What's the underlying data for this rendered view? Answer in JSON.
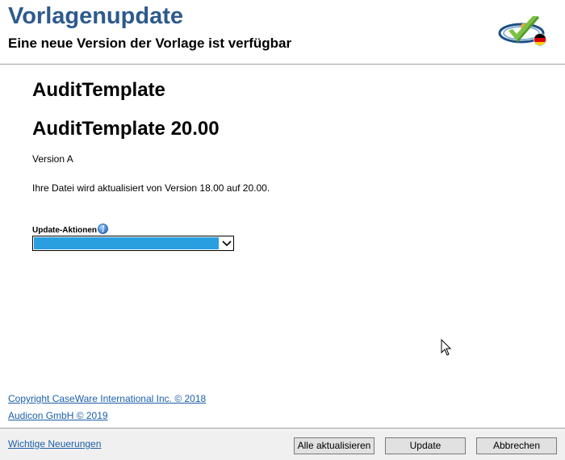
{
  "header": {
    "title": "Vorlagenupdate",
    "subtitle": "Eine neue Version der Vorlage ist verfügbar",
    "logo_icon": "caseware-check-logo-germany",
    "title_color": "#2e5a8c"
  },
  "template": {
    "name": "AuditTemplate",
    "version_title": "AuditTemplate 20.00",
    "version_label": "Version A",
    "update_message": "Ihre Datei wird aktualisiert von Version 18.00 auf 20.00."
  },
  "update_actions": {
    "label": "Update-Aktionen",
    "info_icon": "info-icon",
    "selected_value": "",
    "highlight_color": "#2a9fe0"
  },
  "copyright": {
    "caseware": "Copyright CaseWare International Inc. © 2018",
    "audicon": "Audicon GmbH © 2019"
  },
  "footer": {
    "whats_new_link": "Wichtige Neuerungen",
    "update_all_label": "Alle aktualisieren",
    "update_label": "Update",
    "cancel_label": "Abbrechen"
  }
}
